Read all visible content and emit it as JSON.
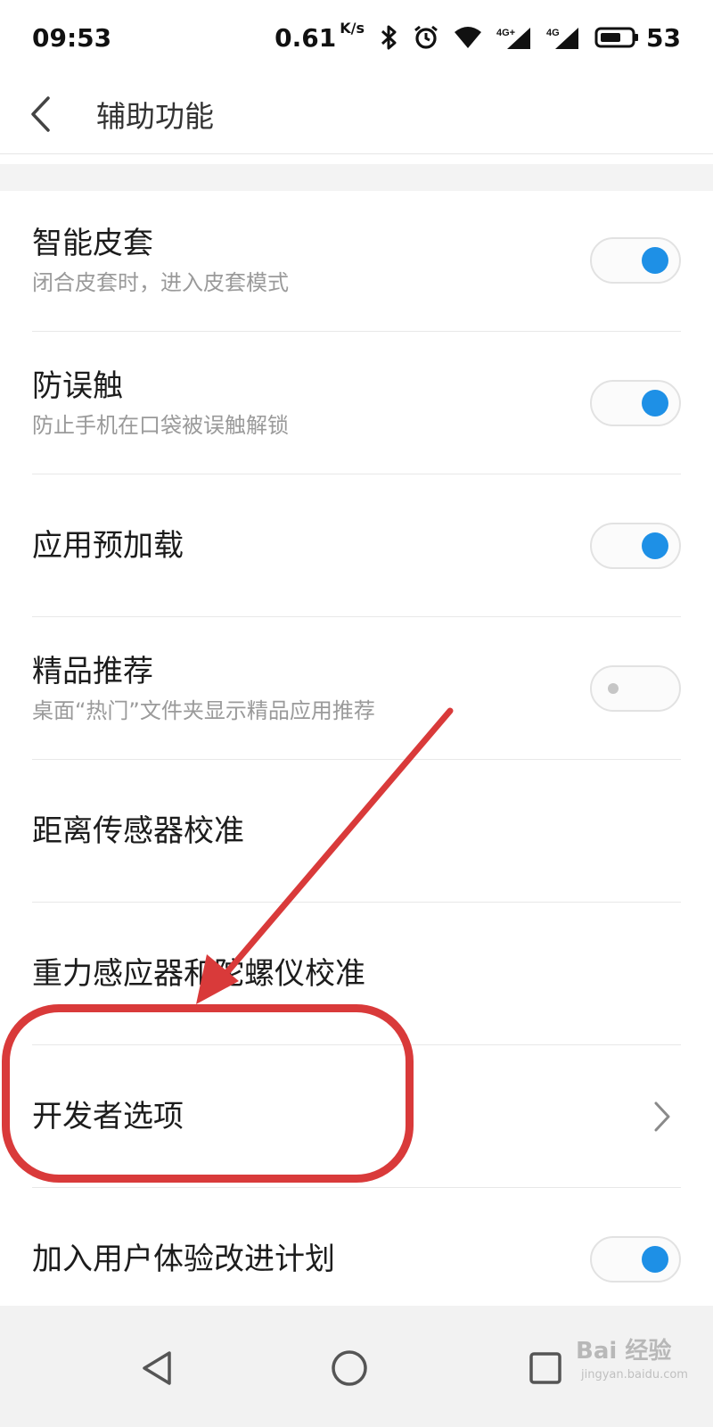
{
  "status_bar": {
    "time": "09:53",
    "net_speed": "0.61",
    "net_speed_unit": "K/s",
    "battery_level": "53",
    "icons": [
      "bluetooth-icon",
      "alarm-icon",
      "wifi-icon",
      "signal-4g-plus-icon",
      "signal-4g-icon",
      "battery-icon"
    ]
  },
  "app_bar": {
    "title": "辅助功能",
    "back_icon": "chevron-left-icon"
  },
  "settings": [
    {
      "title": "智能皮套",
      "subtitle": "闭合皮套时，进入皮套模式",
      "control": "toggle",
      "on": true
    },
    {
      "title": "防误触",
      "subtitle": "防止手机在口袋被误触解锁",
      "control": "toggle",
      "on": true
    },
    {
      "title": "应用预加载",
      "subtitle": "",
      "control": "toggle",
      "on": true
    },
    {
      "title": "精品推荐",
      "subtitle": "桌面“热门”文件夹显示精品应用推荐",
      "control": "toggle",
      "on": false
    },
    {
      "title": "距离传感器校准",
      "subtitle": "",
      "control": "none"
    },
    {
      "title": "重力感应器和陀螺仪校准",
      "subtitle": "",
      "control": "none"
    },
    {
      "title": "开发者选项",
      "subtitle": "",
      "control": "chevron"
    },
    {
      "title": "加入用户体验改进计划",
      "subtitle": "",
      "control": "toggle",
      "on": true
    }
  ],
  "annotation": {
    "highlight_target": "开发者选项",
    "color": "#d93a3a"
  },
  "nav_bar": {
    "icons": [
      "back-triangle-icon",
      "home-circle-icon",
      "recents-square-icon"
    ]
  },
  "watermark": {
    "text": "Bai 经验",
    "sub": "jingyan.baidu.com"
  },
  "colors": {
    "accent": "#1e90e6",
    "annotation_red": "#d93a3a"
  }
}
